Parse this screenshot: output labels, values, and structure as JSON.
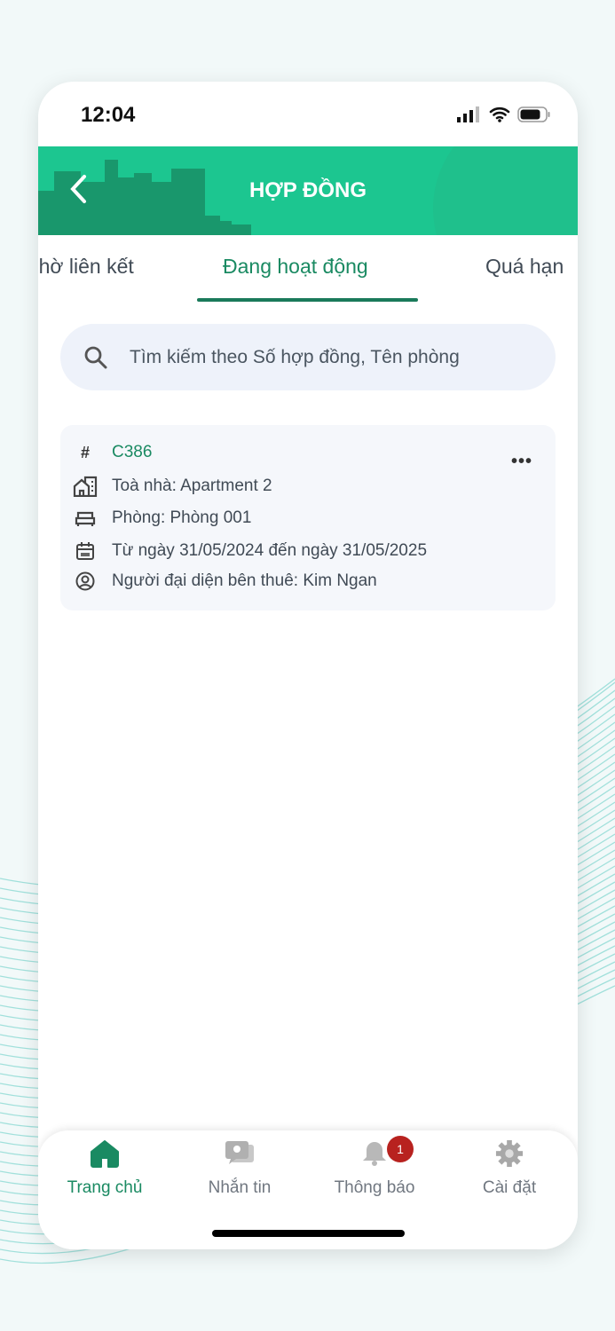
{
  "status_bar": {
    "time": "12:04"
  },
  "header": {
    "title": "HỢP ĐỒNG"
  },
  "tabs": [
    {
      "label": "Chờ liên kết"
    },
    {
      "label": "Đang hoạt động",
      "active": true
    },
    {
      "label": "Quá hạn"
    }
  ],
  "search": {
    "placeholder": "Tìm kiếm theo Số hợp đồng, Tên phòng"
  },
  "contracts": [
    {
      "code": "C386",
      "building": "Toà nhà: Apartment 2",
      "room": "Phòng: Phòng 001",
      "period": "Từ ngày 31/05/2024 đến ngày 31/05/2025",
      "tenant": "Người đại diện bên thuê: Kim Ngan"
    }
  ],
  "bottom_nav": [
    {
      "label": "Trang chủ",
      "icon": "home-icon",
      "active": true
    },
    {
      "label": "Nhắn tin",
      "icon": "chat-icon"
    },
    {
      "label": "Thông báo",
      "icon": "bell-icon",
      "badge": "1"
    },
    {
      "label": "Cài đặt",
      "icon": "gear-icon"
    }
  ],
  "colors": {
    "primary": "#1cc690",
    "accent": "#1a8a62",
    "badge": "#b8221f"
  }
}
